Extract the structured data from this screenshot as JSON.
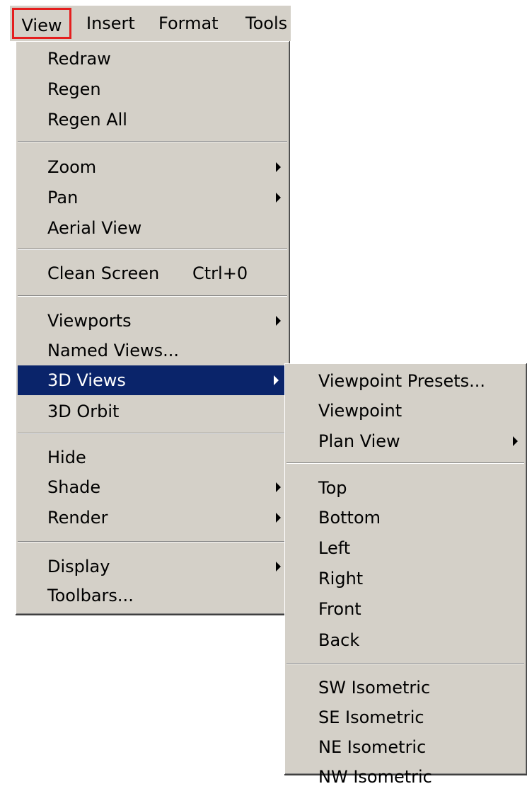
{
  "menubar": {
    "items": [
      {
        "label": "View"
      },
      {
        "label": "Insert"
      },
      {
        "label": "Format"
      },
      {
        "label": "Tools"
      }
    ]
  },
  "view_menu": {
    "items": [
      {
        "label": "Redraw"
      },
      {
        "label": "Regen"
      },
      {
        "label": "Regen All"
      },
      {
        "label": "Zoom",
        "submenu": true
      },
      {
        "label": "Pan",
        "submenu": true
      },
      {
        "label": "Aerial View"
      },
      {
        "label": "Clean Screen",
        "shortcut": "Ctrl+0"
      },
      {
        "label": "Viewports",
        "submenu": true
      },
      {
        "label": "Named Views..."
      },
      {
        "label": "3D Views",
        "submenu": true,
        "highlighted": true
      },
      {
        "label": "3D Orbit"
      },
      {
        "label": "Hide"
      },
      {
        "label": "Shade",
        "submenu": true
      },
      {
        "label": "Render",
        "submenu": true
      },
      {
        "label": "Display",
        "submenu": true
      },
      {
        "label": "Toolbars..."
      }
    ]
  },
  "views_3d_submenu": {
    "items": [
      {
        "label": "Viewpoint Presets..."
      },
      {
        "label": "Viewpoint"
      },
      {
        "label": "Plan View",
        "submenu": true
      },
      {
        "label": "Top"
      },
      {
        "label": "Bottom"
      },
      {
        "label": "Left"
      },
      {
        "label": "Right"
      },
      {
        "label": "Front"
      },
      {
        "label": "Back"
      },
      {
        "label": "SW Isometric"
      },
      {
        "label": "SE Isometric"
      },
      {
        "label": "NE Isometric"
      },
      {
        "label": "NW Isometric"
      }
    ]
  },
  "colors": {
    "menu_background": "#d4d0c8",
    "highlight_background": "#0a246a",
    "highlight_text": "#ffffff",
    "callout_border": "#e41e1e"
  },
  "icons": {
    "submenu_indicator": "chevron-right-icon"
  }
}
